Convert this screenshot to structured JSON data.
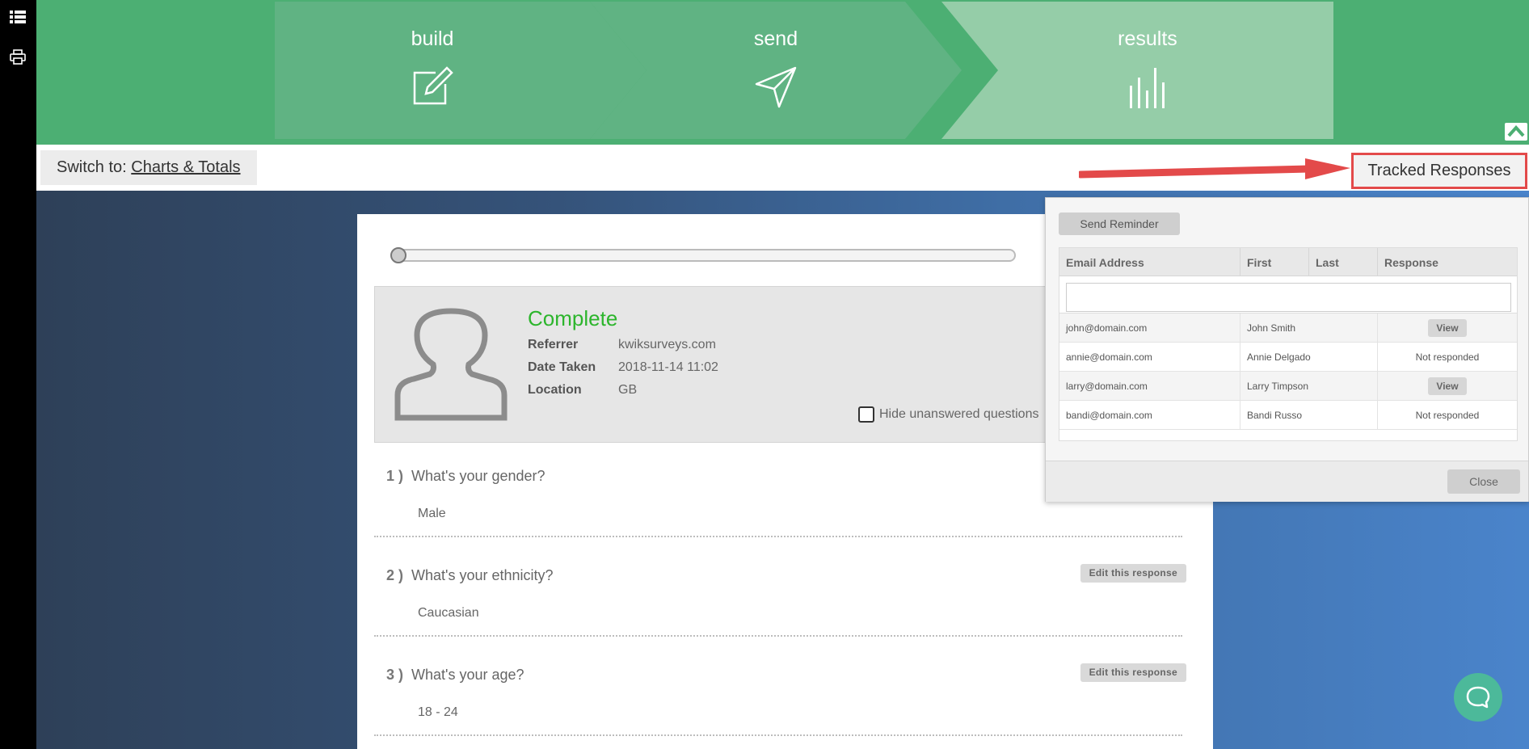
{
  "steps": [
    {
      "label": "build"
    },
    {
      "label": "send"
    },
    {
      "label": "results"
    }
  ],
  "switchbar": {
    "prefix": "Switch to:",
    "link": "Charts & Totals",
    "tracked_button": "Tracked Responses"
  },
  "response": {
    "status": "Complete",
    "referrer_label": "Referrer",
    "referrer_value": "kwiksurveys.com",
    "date_label": "Date Taken",
    "date_value": "2018-11-14 11:02",
    "location_label": "Location",
    "location_value": "GB",
    "hide_unanswered": "Hide unanswered questions"
  },
  "questions": [
    {
      "num": "1 )",
      "text": "What's your gender?",
      "answer": "Male",
      "edit": ""
    },
    {
      "num": "2 )",
      "text": "What's your ethnicity?",
      "answer": "Caucasian",
      "edit": "Edit this response"
    },
    {
      "num": "3 )",
      "text": "What's your age?",
      "answer": "18 - 24",
      "edit": "Edit this response"
    }
  ],
  "popup": {
    "send_reminder": "Send Reminder",
    "columns": [
      "Email Address",
      "First",
      "Last",
      "Response"
    ],
    "rows": [
      {
        "email": "john@domain.com",
        "name": "John Smith",
        "response": "View"
      },
      {
        "email": "annie@domain.com",
        "name": "Annie Delgado",
        "response": "Not responded"
      },
      {
        "email": "larry@domain.com",
        "name": "Larry Timpson",
        "response": "View"
      },
      {
        "email": "bandi@domain.com",
        "name": "Bandi Russo",
        "response": "Not responded"
      }
    ],
    "close": "Close"
  },
  "colors": {
    "brand_green": "#4caf73",
    "complete_green": "#2cb52c",
    "highlight_red": "#e34a4a"
  }
}
